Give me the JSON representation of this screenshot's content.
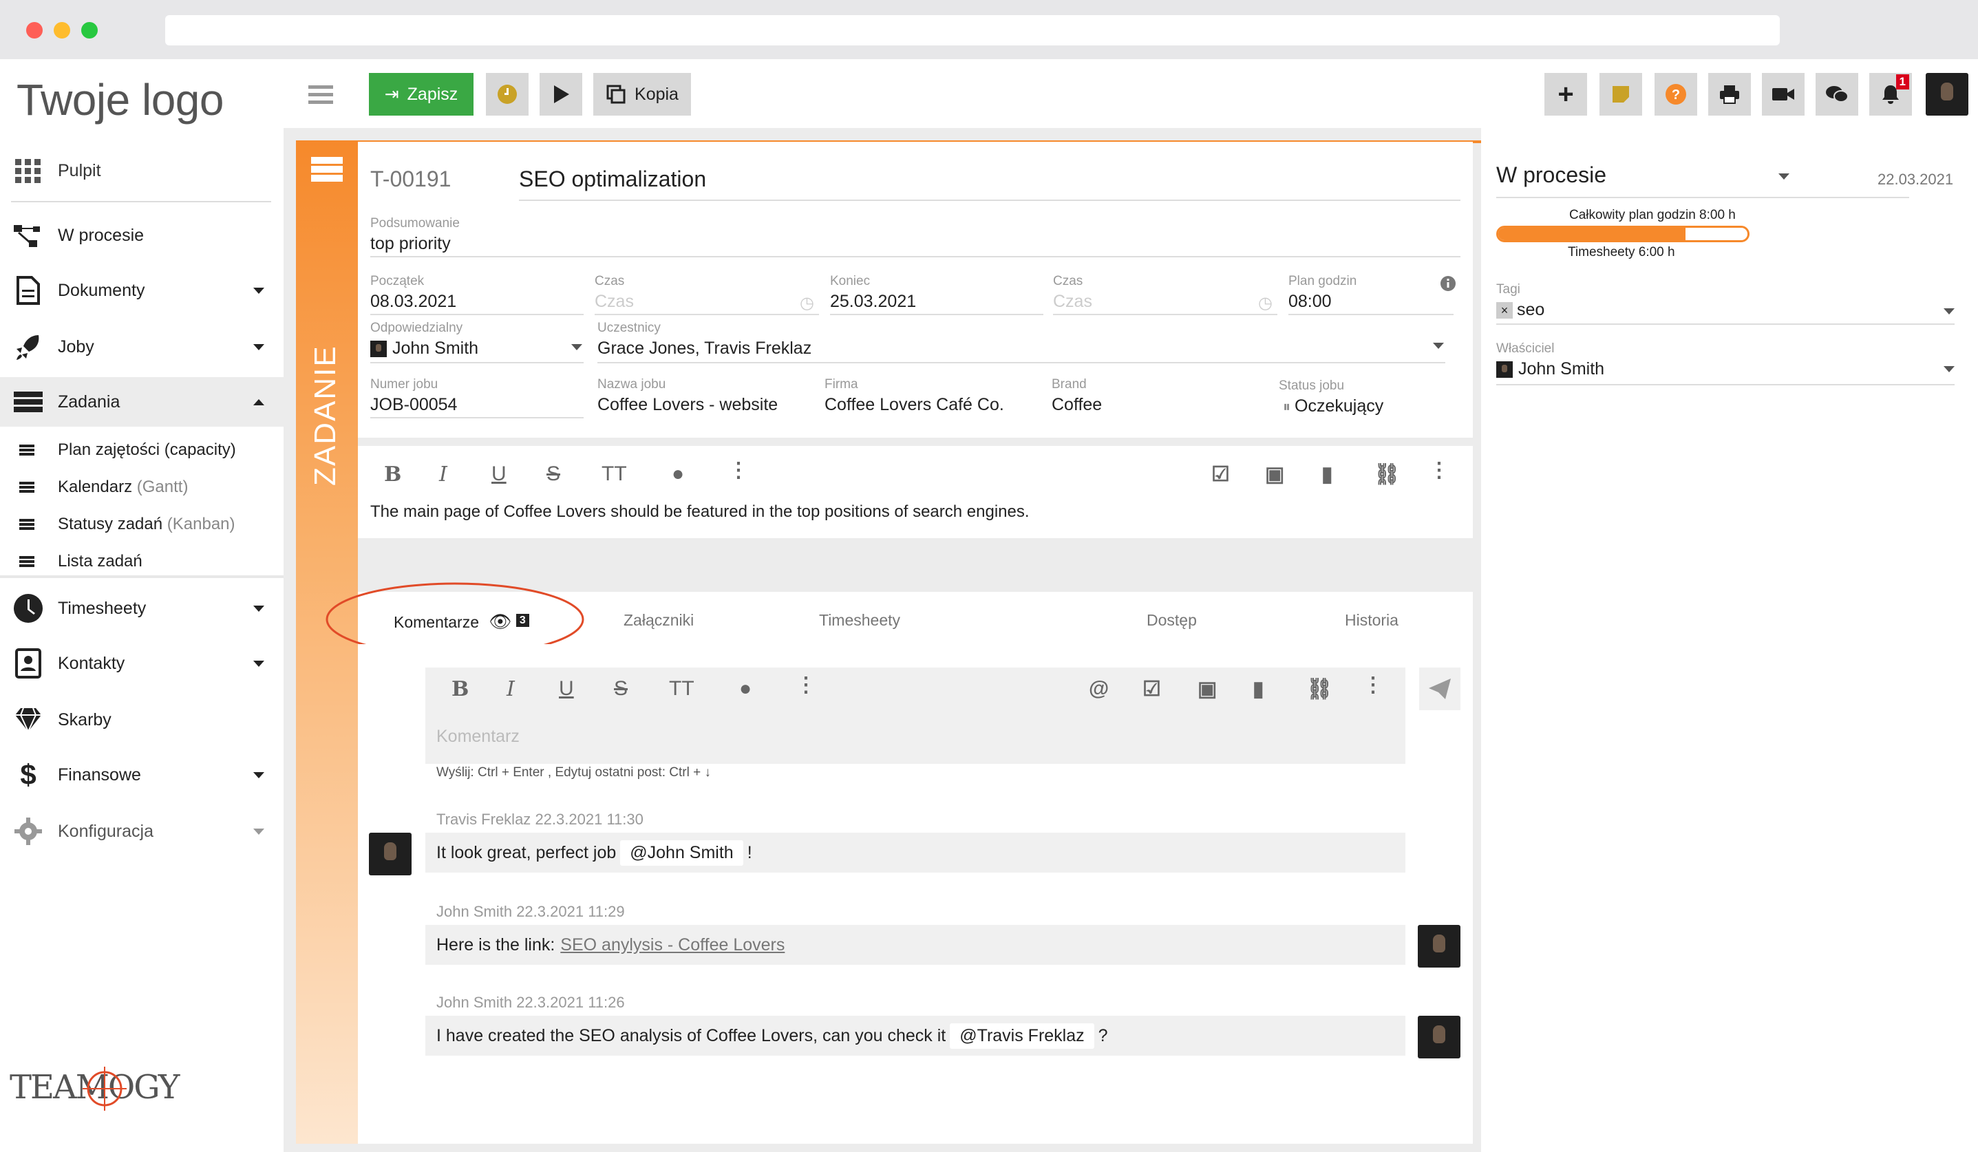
{
  "brand": {
    "logo_text": "Twoje logo",
    "footer_logo": "TEAMOGY"
  },
  "sidebar": {
    "items": [
      {
        "label": "Pulpit"
      },
      {
        "label": "W procesie"
      },
      {
        "label": "Dokumenty"
      },
      {
        "label": "Joby"
      },
      {
        "label": "Zadania"
      },
      {
        "label": "Timesheety"
      },
      {
        "label": "Kontakty"
      },
      {
        "label": "Skarby"
      },
      {
        "label": "Finansowe"
      },
      {
        "label": "Konfiguracja"
      }
    ],
    "sub_items": [
      {
        "label": "Plan zajętości (capacity)",
        "muted": ""
      },
      {
        "label": "Kalendarz",
        "muted": "(Gantt)"
      },
      {
        "label": "Statusy zadań",
        "muted": "(Kanban)"
      },
      {
        "label": "Lista zadań",
        "muted": ""
      }
    ]
  },
  "toolbar": {
    "save_label": "Zapisz",
    "copy_label": "Kopia",
    "notification_count": "1"
  },
  "task": {
    "strip_label": "ZADANIE",
    "id": "T-00191",
    "title": "SEO optimalization",
    "summary_label": "Podsumowanie",
    "summary_value": "top priority",
    "start_label": "Początek",
    "start_value": "08.03.2021",
    "time_label": "Czas",
    "time_placeholder": "Czas",
    "end_label": "Koniec",
    "end_value": "25.03.2021",
    "plan_label": "Plan godzin",
    "plan_value": "08:00",
    "responsible_label": "Odpowiedzialny",
    "responsible_value": "John Smith",
    "participants_label": "Uczestnicy",
    "participants_value": "Grace Jones, Travis Freklaz",
    "job_number_label": "Numer jobu",
    "job_number_value": "JOB-00054",
    "job_name_label": "Nazwa jobu",
    "job_name_value": "Coffee Lovers - website",
    "company_label": "Firma",
    "company_value": "Coffee Lovers Café Co.",
    "brand_label": "Brand",
    "brand_value": "Coffee",
    "job_status_label": "Status jobu",
    "job_status_value": "Oczekujący",
    "description": "The main page of Coffee Lovers should be featured in the top positions of search engines."
  },
  "tabs": [
    {
      "label": "Komentarze",
      "count": "3"
    },
    {
      "label": "Załączniki"
    },
    {
      "label": "Timesheety"
    },
    {
      "label": "Dostęp"
    },
    {
      "label": "Historia"
    }
  ],
  "comment_box": {
    "placeholder": "Komentarz",
    "hint": "Wyślij: Ctrl + Enter , Edytuj ostatni post: Ctrl + ↓"
  },
  "comments": [
    {
      "author": "Travis Freklaz",
      "date": "22.3.2021",
      "time": "11:30",
      "pre": "It look great, perfect job",
      "mention": "@John Smith",
      "post": "!"
    },
    {
      "author": "John Smith",
      "date": "22.3.2021",
      "time": "11:29",
      "pre": "Here is the link:",
      "link": "SEO anylysis - Coffee Lovers"
    },
    {
      "author": "John Smith",
      "date": "22.3.2021",
      "time": "11:26",
      "pre": "I have created the SEO analysis of Coffee Lovers, can you check it",
      "mention": "@Travis Freklaz",
      "post": "?"
    }
  ],
  "right": {
    "status": "W procesie",
    "date": "22.03.2021",
    "plan_text": "Całkowity plan godzin 8:00 h",
    "timesheet_text": "Timesheety 6:00 h",
    "progress": 0.75,
    "tags_label": "Tagi",
    "tag_value": "seo",
    "owner_label": "Właściciel",
    "owner_value": "John Smith"
  },
  "colors": {
    "accent": "#f6892b",
    "save": "#3aa844",
    "bg": "#ececec"
  }
}
